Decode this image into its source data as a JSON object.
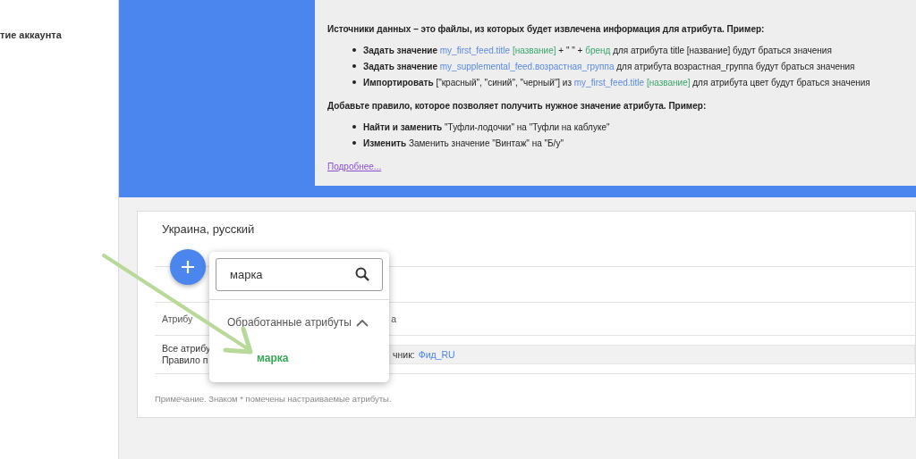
{
  "sidebar": {
    "item": "тие аккаунта"
  },
  "info": {
    "sections": [
      {
        "heading": "Источники данных – это файлы, из которых будет извлечена информация для атрибута. Пример:",
        "bullets": [
          [
            {
              "kind": "bold",
              "text": "Задать значение "
            },
            {
              "kind": "field",
              "text": "my_first_feed.title "
            },
            {
              "kind": "tag",
              "text": "[название]"
            },
            {
              "kind": "plain",
              "text": " + \" \" + "
            },
            {
              "kind": "tag",
              "text": "бренд"
            },
            {
              "kind": "plain",
              "text": " для атрибута title [название] будут браться значения"
            }
          ],
          [
            {
              "kind": "bold",
              "text": "Задать значение "
            },
            {
              "kind": "field",
              "text": "my_supplemental_feed.возрастная_группа"
            },
            {
              "kind": "plain",
              "text": " для атрибута возрастная_группа будут браться значения"
            }
          ],
          [
            {
              "kind": "bold",
              "text": "Импортировать "
            },
            {
              "kind": "plain",
              "text": "[\"красный\", \"синий\", \"черный\"] из "
            },
            {
              "kind": "field",
              "text": "my_first_feed.title "
            },
            {
              "kind": "tag",
              "text": "[название]"
            },
            {
              "kind": "plain",
              "text": " для атрибута цвет будут браться значения"
            }
          ]
        ]
      },
      {
        "heading": "Добавьте правило, которое позволяет получить нужное значение атрибута. Пример:",
        "bullets": [
          [
            {
              "kind": "bold",
              "text": "Найти и заменить "
            },
            {
              "kind": "plain",
              "text": "\"Туфли-лодочки\" на \"Туфли на каблуке\""
            }
          ],
          [
            {
              "kind": "bold",
              "text": "Изменить "
            },
            {
              "kind": "plain",
              "text": "Заменить значение \"Винтаж\" на \"Б/у\""
            }
          ]
        ]
      }
    ],
    "link": "Подробнее..."
  },
  "card": {
    "title": "Украина, русский",
    "table": {
      "header": [
        "Атрибу",
        "а"
      ],
      "row": {
        "lines": [
          "Все атрибу",
          "Правило п"
        ],
        "source_label": "чник:",
        "source_link": "Фид_RU"
      }
    },
    "note": "Примечание. Знаком * помечены настраиваемые атрибуты."
  },
  "popup": {
    "search": {
      "value": "марка"
    },
    "group": {
      "label": "Обработанные атрибуты",
      "expanded": true,
      "items": [
        "марка"
      ]
    }
  }
}
